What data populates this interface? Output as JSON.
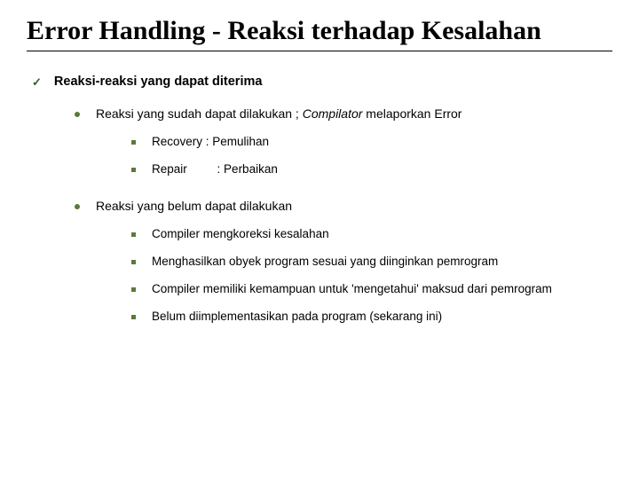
{
  "title": "Error Handling - Reaksi terhadap Kesalahan",
  "lvl1": {
    "text": "Reaksi-reaksi yang dapat diterima"
  },
  "section1": {
    "heading_pre": "Reaksi yang sudah dapat dilakukan ; ",
    "heading_italic": "Compilator",
    "heading_post": " melaporkan Error",
    "items": [
      {
        "text": "Recovery : Pemulihan"
      },
      {
        "text": "Repair     : Perbaikan"
      }
    ]
  },
  "section2": {
    "heading": "Reaksi yang belum dapat dilakukan",
    "items": [
      {
        "text": "Compiler mengkoreksi kesalahan"
      },
      {
        "text": "Menghasilkan obyek program sesuai yang diinginkan pemrogram"
      },
      {
        "text": "Compiler memiliki kemampuan untuk 'mengetahui' maksud dari pemrogram"
      },
      {
        "text": "Belum diimplementasikan pada program (sekarang ini)"
      }
    ]
  }
}
